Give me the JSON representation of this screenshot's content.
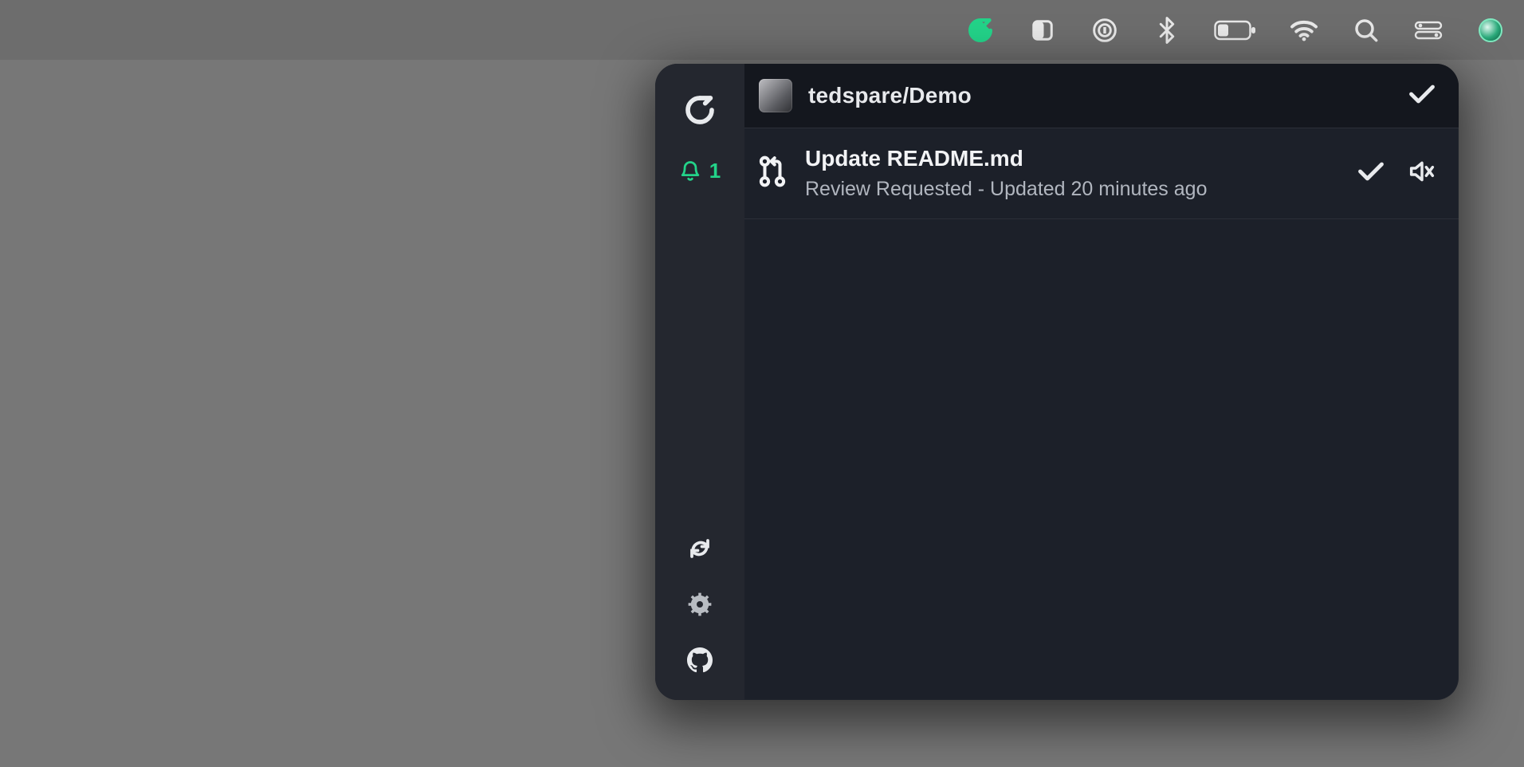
{
  "colors": {
    "accent": "#23d389"
  },
  "menubar": {
    "items": [
      "gitify-icon",
      "window-icon",
      "power-icon",
      "bluetooth-icon",
      "battery-icon",
      "wifi-icon",
      "search-icon",
      "control-center-icon",
      "user-avatar"
    ]
  },
  "rail": {
    "notification_count": "1"
  },
  "repo": {
    "name": "tedspare/Demo"
  },
  "notification": {
    "title": "Update README.md",
    "subtitle": "Review Requested - Updated 20 minutes ago"
  }
}
